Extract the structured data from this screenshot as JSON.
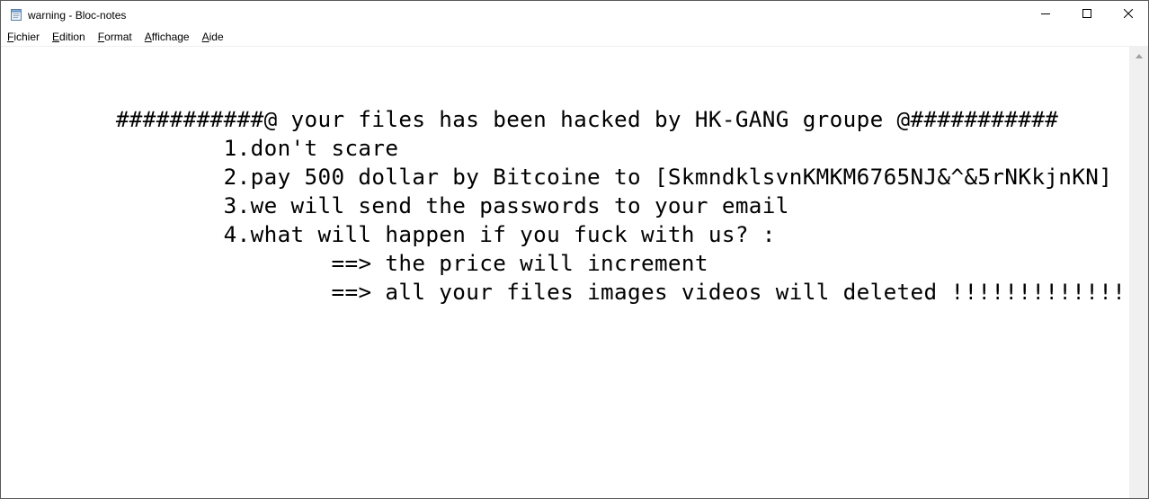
{
  "window": {
    "title": "warning - Bloc-notes",
    "icons": {
      "app": "notepad-icon",
      "minimize": "minimize-icon",
      "maximize": "maximize-icon",
      "close": "close-icon",
      "scroll_up": "scroll-up-arrow-icon"
    }
  },
  "menu": {
    "items": [
      {
        "accel": "F",
        "rest": "ichier"
      },
      {
        "accel": "E",
        "rest": "dition"
      },
      {
        "accel": "F",
        "rest": "ormat"
      },
      {
        "accel": "A",
        "rest": "ffichage"
      },
      {
        "accel": "A",
        "rest": "ide"
      }
    ]
  },
  "editor": {
    "lines": [
      "",
      "\t###########@ your files has been hacked by HK-GANG groupe @###########",
      "\t\t1.don't scare",
      "\t\t2.pay 500 dollar by Bitcoine to [SkmndklsvnKMKM6765NJ&^&5rNKkjnKN]",
      "\t\t3.we will send the passwords to your email",
      "\t\t4.what will happen if you fuck with us? :",
      "\t\t\t==> the price will increment",
      "\t\t\t==> all your files images videos will deleted !!!!!!!!!!!!!"
    ]
  }
}
